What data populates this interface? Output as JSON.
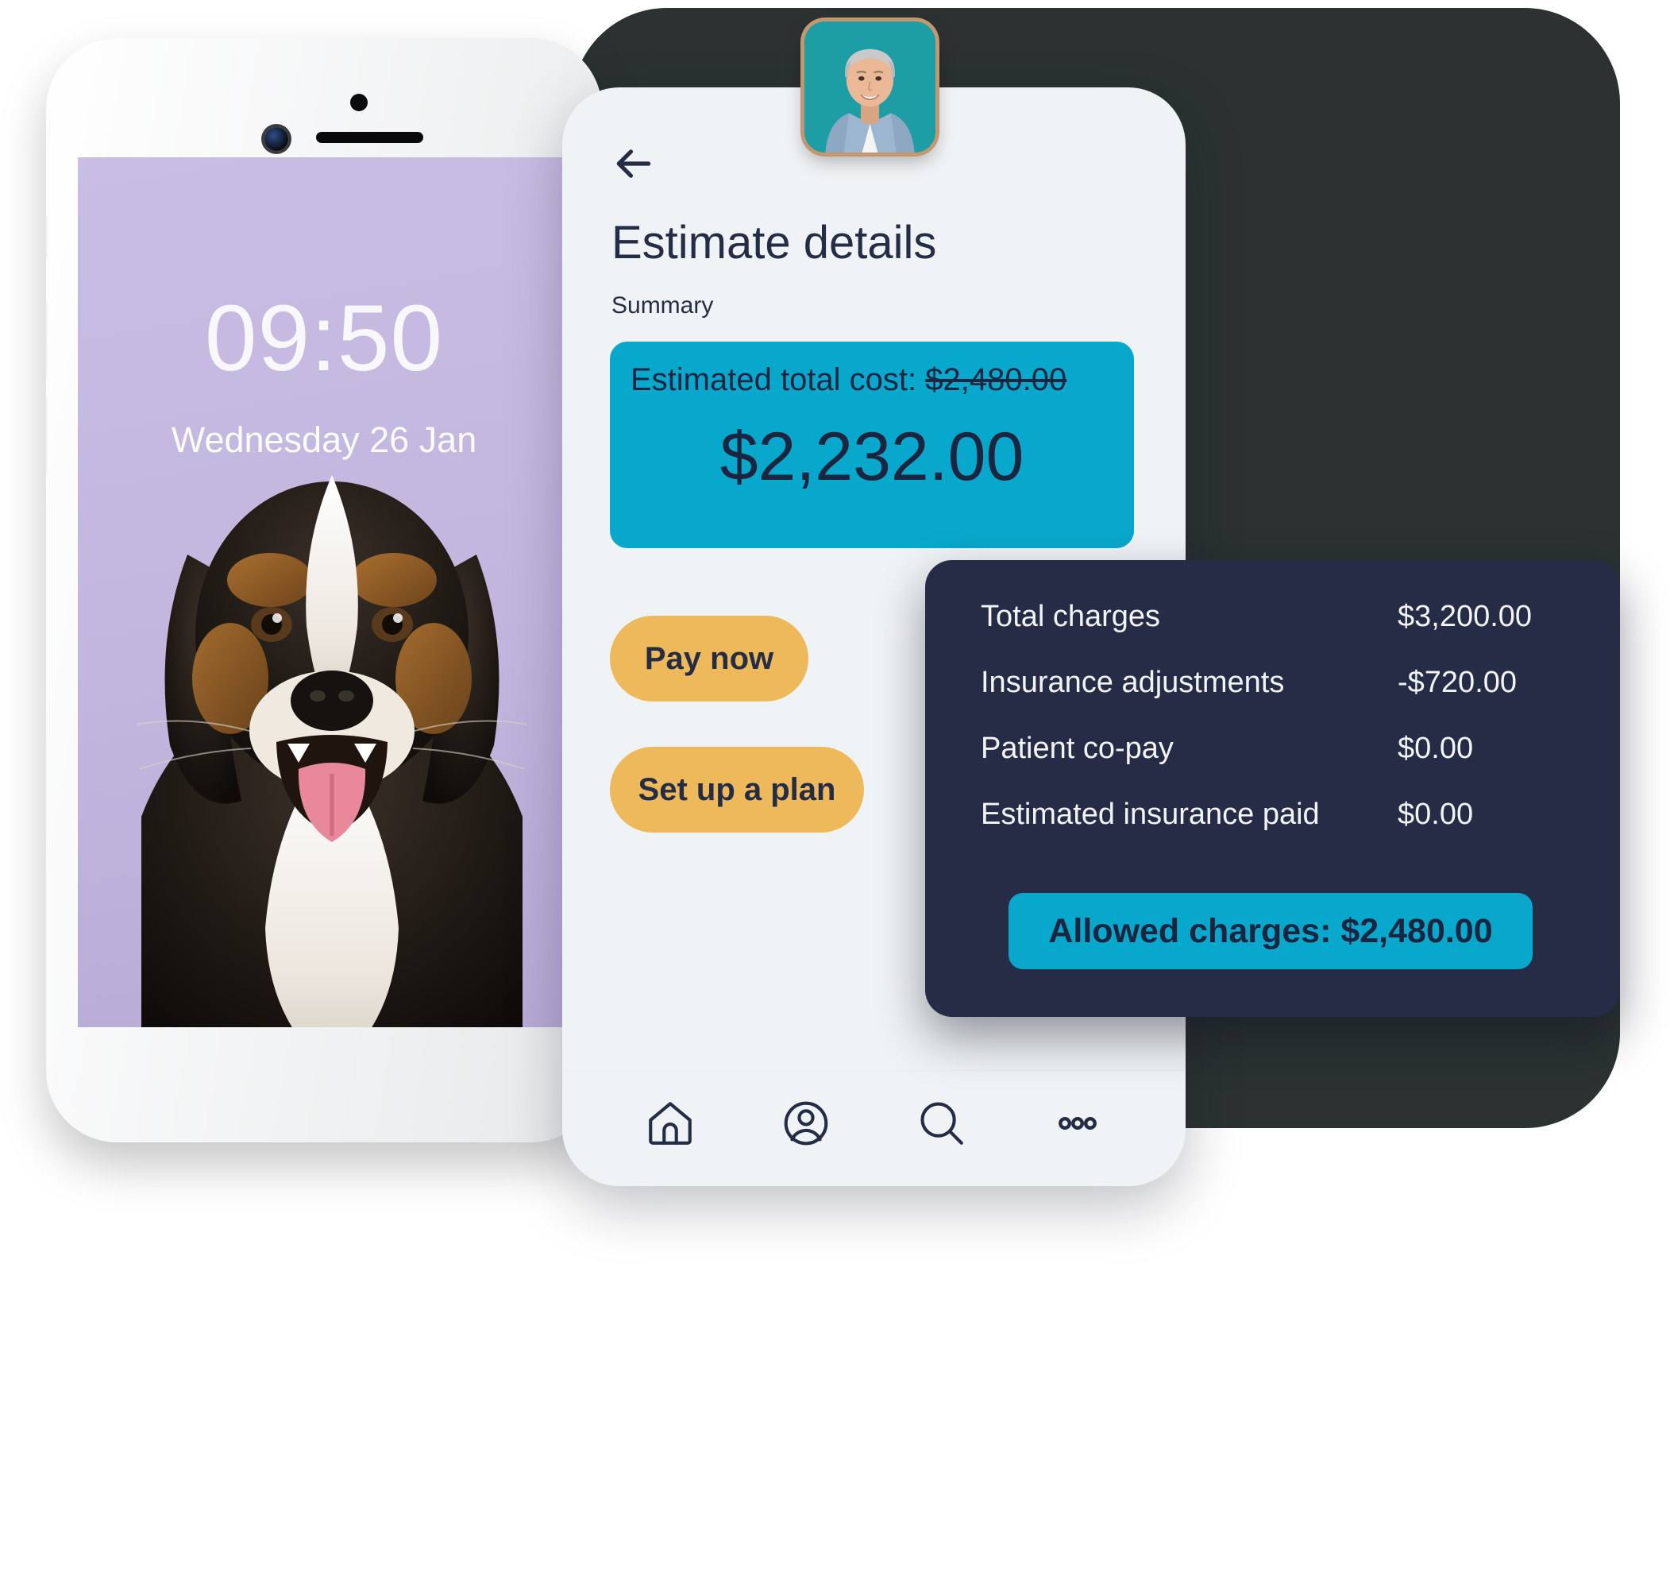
{
  "colors": {
    "teal": "#08a8cc",
    "navy": "#262c45",
    "yellow": "#eeb95a",
    "card_bg": "#f0f3f5",
    "lavender": "#c5bae1",
    "tablet": "#2b3231",
    "avatar_border": "#c39870"
  },
  "lock_screen": {
    "time": "09:50",
    "date": "Wednesday 26 Jan"
  },
  "app": {
    "back_icon": "arrow-left-icon",
    "title": "Estimate details",
    "section_label": "Summary",
    "cost_card": {
      "label_prefix": "Estimated total cost: ",
      "original_amount": "$2,480.00",
      "discounted_amount": "$2,232.00"
    },
    "actions": {
      "pay_now": "Pay now",
      "set_up_plan": "Set up a plan"
    },
    "bottom_nav": [
      {
        "icon": "home-icon",
        "name": "home"
      },
      {
        "icon": "user-circle-icon",
        "name": "profile"
      },
      {
        "icon": "search-icon",
        "name": "search"
      },
      {
        "icon": "more-horizontal-icon",
        "name": "more"
      }
    ]
  },
  "details_panel": {
    "rows": [
      {
        "label": "Total charges",
        "amount": "$3,200.00"
      },
      {
        "label": "Insurance adjustments",
        "amount": "-$720.00"
      },
      {
        "label": "Patient co-pay",
        "amount": "$0.00"
      },
      {
        "label": "Estimated insurance paid",
        "amount": "$0.00"
      }
    ],
    "allowed_charges": "Allowed charges: $2,480.00"
  },
  "avatar": {
    "alt": "smiling-woman-portrait"
  }
}
